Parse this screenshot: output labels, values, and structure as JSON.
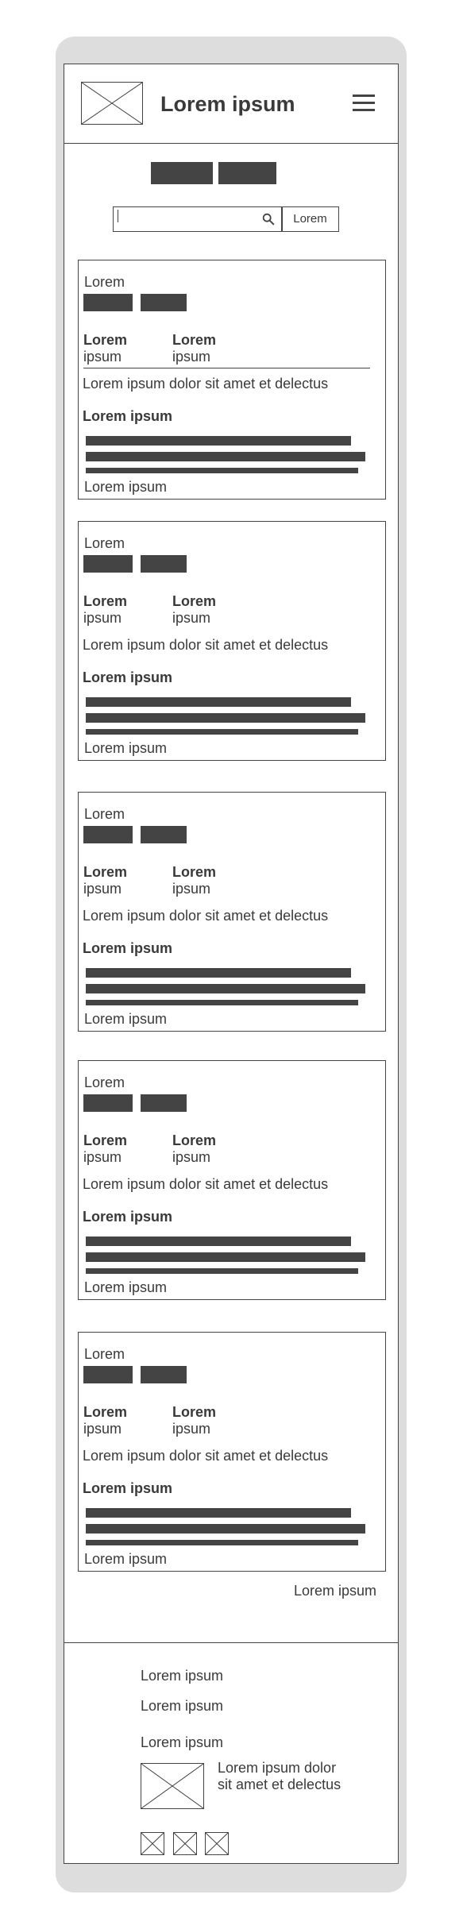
{
  "header": {
    "logo_icon": "image-placeholder-icon",
    "title": "Lorem ipsum",
    "menu_icon": "hamburger-menu-icon"
  },
  "search": {
    "placeholder": "",
    "icon": "search-icon",
    "button_label": "Lorem"
  },
  "cards": [
    {
      "title": "Lorem",
      "k1_label": "Lorem",
      "k1_value": "ipsum",
      "k2_label": "Lorem",
      "k2_value": "ipsum",
      "description": "Lorem ipsum dolor sit amet et delectus",
      "subheading": "Lorem ipsum",
      "footer": "Lorem ipsum"
    },
    {
      "title": "Lorem",
      "k1_label": "Lorem",
      "k1_value": "ipsum",
      "k2_label": "Lorem",
      "k2_value": "ipsum",
      "description": "Lorem ipsum dolor sit amet et delectus",
      "subheading": "Lorem ipsum",
      "footer": "Lorem ipsum"
    },
    {
      "title": "Lorem",
      "k1_label": "Lorem",
      "k1_value": "ipsum",
      "k2_label": "Lorem",
      "k2_value": "ipsum",
      "description": "Lorem ipsum dolor sit amet et delectus",
      "subheading": "Lorem ipsum",
      "footer": "Lorem ipsum"
    },
    {
      "title": "Lorem",
      "k1_label": "Lorem",
      "k1_value": "ipsum",
      "k2_label": "Lorem",
      "k2_value": "ipsum",
      "description": "Lorem ipsum dolor sit amet et delectus",
      "subheading": "Lorem ipsum",
      "footer": "Lorem ipsum"
    },
    {
      "title": "Lorem",
      "k1_label": "Lorem",
      "k1_value": "ipsum",
      "k2_label": "Lorem",
      "k2_value": "ipsum",
      "description": "Lorem ipsum dolor sit amet et delectus",
      "subheading": "Lorem ipsum",
      "footer": "Lorem ipsum"
    }
  ],
  "more_link": "Lorem ipsum",
  "footer": {
    "links": [
      "Lorem ipsum",
      "Lorem ipsum",
      "Lorem ipsum"
    ],
    "text": "Lorem ipsum dolor sit amet et delectus",
    "image_icon": "image-placeholder-icon",
    "social_icons": [
      "image-placeholder-icon",
      "image-placeholder-icon",
      "image-placeholder-icon"
    ]
  },
  "colors": {
    "frame": "#dddddd",
    "stroke": "#444444",
    "text": "#3a3a3a"
  }
}
